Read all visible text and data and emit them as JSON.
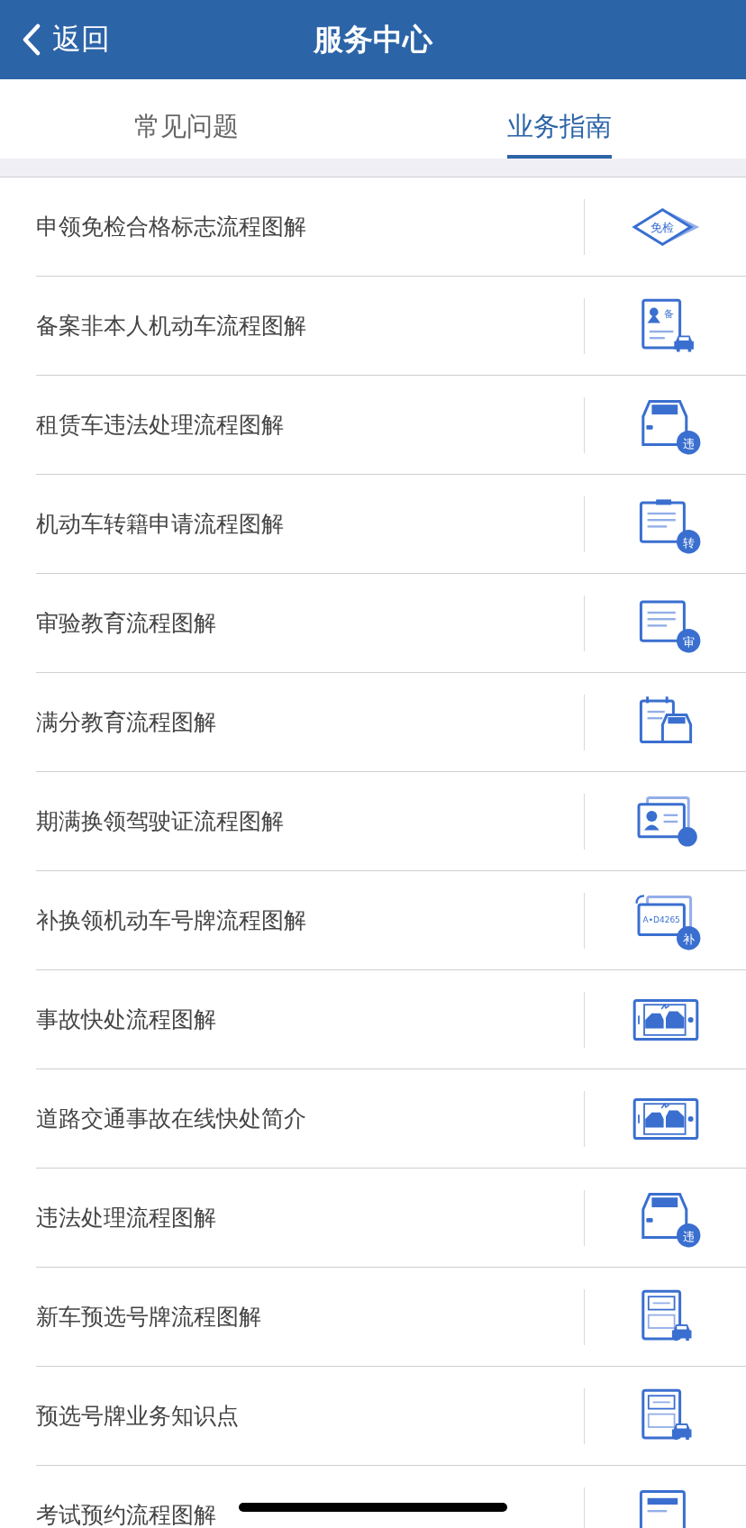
{
  "header": {
    "back": "返回",
    "title": "服务中心"
  },
  "tabs": [
    {
      "label": "常见问题",
      "selected": false
    },
    {
      "label": "业务指南",
      "selected": true
    }
  ],
  "items": [
    {
      "label": "申领免检合格标志流程图解",
      "kind": "diamond",
      "badge": "免检"
    },
    {
      "label": "备案非本人机动车流程图解",
      "kind": "doc-car",
      "badge": "备"
    },
    {
      "label": "租赁车违法处理流程图解",
      "kind": "car-badge",
      "badge": "违"
    },
    {
      "label": "机动车转籍申请流程图解",
      "kind": "clipboard-badge",
      "badge": "转"
    },
    {
      "label": "审验教育流程图解",
      "kind": "doc-badge",
      "badge": "审"
    },
    {
      "label": "满分教育流程图解",
      "kind": "calendar-car"
    },
    {
      "label": "期满换领驾驶证流程图解",
      "kind": "id-card"
    },
    {
      "label": "补换领机动车号牌流程图解",
      "kind": "plate",
      "badge": "补",
      "plate": "A•D4265"
    },
    {
      "label": "事故快处流程图解",
      "kind": "phone-crash"
    },
    {
      "label": "道路交通事故在线快处简介",
      "kind": "phone-crash"
    },
    {
      "label": "违法处理流程图解",
      "kind": "car-badge",
      "badge": "违"
    },
    {
      "label": "新车预选号牌流程图解",
      "kind": "plate-car"
    },
    {
      "label": "预选号牌业务知识点",
      "kind": "plate-car"
    },
    {
      "label": "考试预约流程图解",
      "kind": "form"
    }
  ]
}
